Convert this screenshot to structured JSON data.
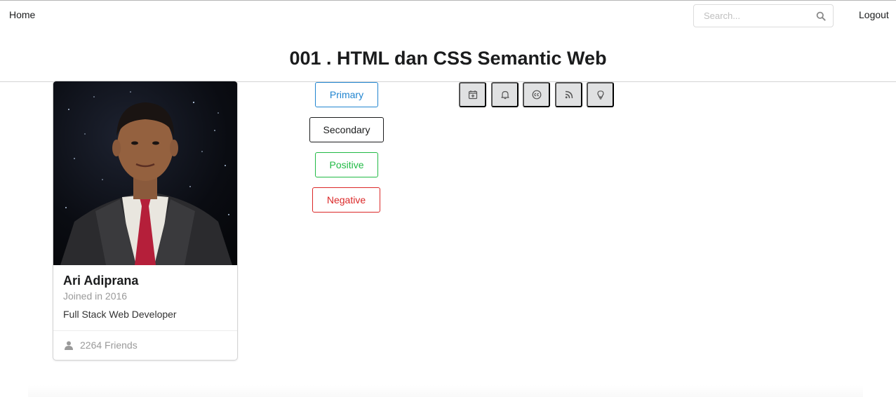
{
  "nav": {
    "home_label": "Home",
    "logout_label": "Logout",
    "search": {
      "placeholder": "Search..."
    }
  },
  "page": {
    "title": "001 . HTML dan CSS Semantic Web"
  },
  "profile_card": {
    "name": "Ari Adiprana",
    "joined": "Joined in 2016",
    "description": "Full Stack Web Developer",
    "friends": "2264 Friends",
    "friends_icon": "user-icon"
  },
  "buttons": {
    "primary": "Primary",
    "secondary": "Secondary",
    "positive": "Positive",
    "negative": "Negative"
  },
  "icon_buttons": [
    "calendar-plus-icon",
    "bell-icon",
    "closed-captions-icon",
    "rss-icon",
    "lightbulb-icon"
  ],
  "colors": {
    "primary": "#2185d0",
    "secondary": "#1b1c1d",
    "positive": "#21ba45",
    "negative": "#db2828",
    "icon_button_bg": "#e0e1e2"
  }
}
